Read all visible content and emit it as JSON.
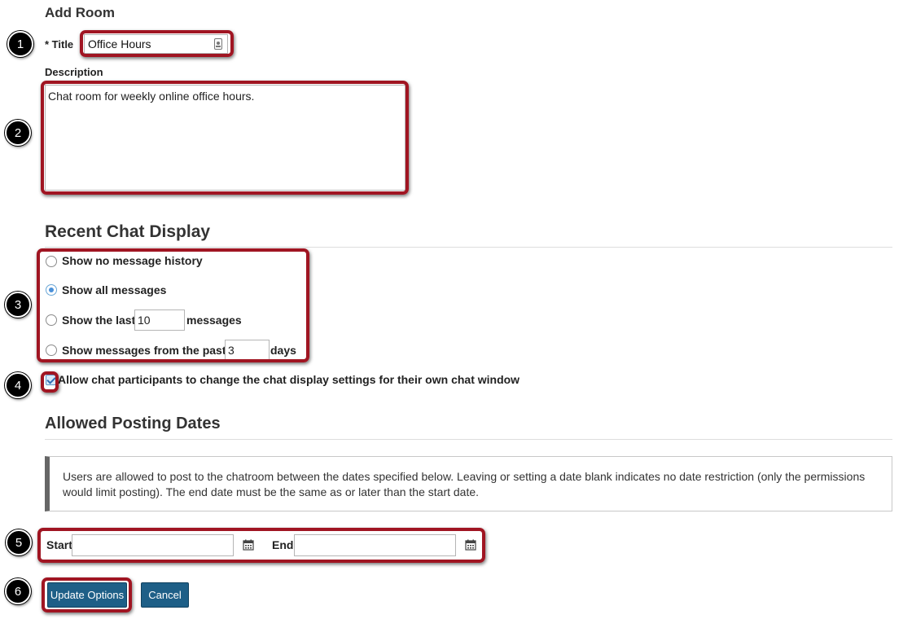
{
  "form": {
    "heading": "Add Room",
    "title_label": "* Title",
    "title_value": "Office Hours",
    "description_label": "Description",
    "description_value": "Chat room for weekly online office hours."
  },
  "recent_chat": {
    "heading": "Recent Chat Display",
    "options": [
      {
        "label": "Show no message history",
        "checked": false
      },
      {
        "label": "Show all messages",
        "checked": true
      },
      {
        "label_before": "Show the last",
        "value": "10",
        "label_after": "messages",
        "checked": false
      },
      {
        "label_before": "Show messages from the past",
        "value": "3",
        "label_after": "days",
        "checked": false
      }
    ],
    "allow_label": "Allow chat participants to change the chat display settings for their own chat window",
    "allow_checked": true
  },
  "posting_dates": {
    "heading": "Allowed Posting Dates",
    "info_text": "Users are allowed to post to the chatroom between the dates specified below. Leaving or setting a date blank indicates no date restriction (only the permissions would limit posting). The end date must be the same as or later than the start date.",
    "start_label": "Start",
    "start_value": "",
    "end_label": "End",
    "end_value": ""
  },
  "buttons": {
    "update": "Update Options",
    "cancel": "Cancel"
  },
  "callouts": [
    "1",
    "2",
    "3",
    "4",
    "5",
    "6"
  ],
  "colors": {
    "highlight": "#a01522",
    "button": "#1e5f87",
    "radio_checked": "#4a90d9"
  },
  "icons": [
    "id-badge-icon",
    "calendar-icon",
    "calendar-icon"
  ]
}
